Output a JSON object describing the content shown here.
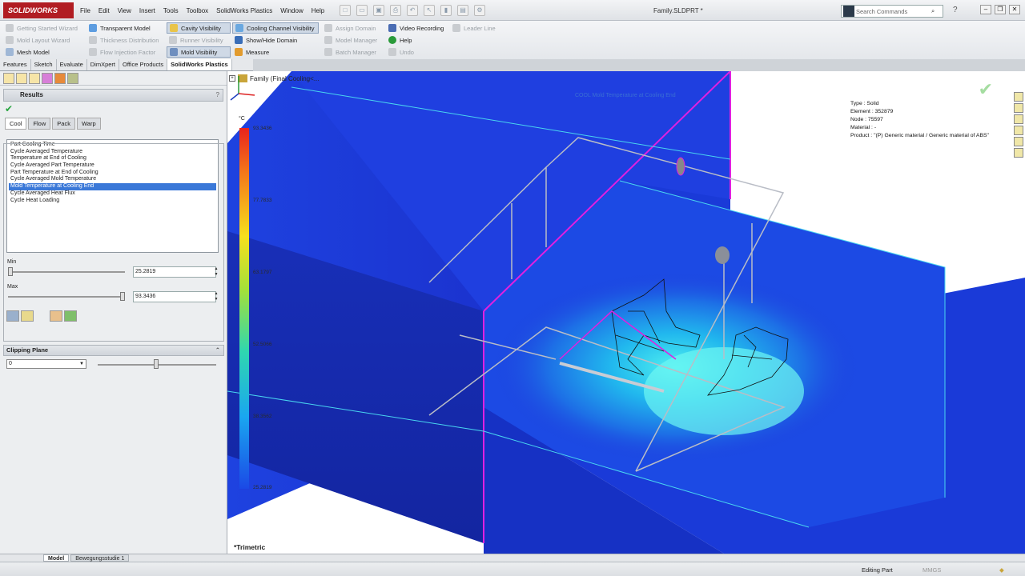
{
  "app": {
    "brand": "SOLIDWORKS",
    "document": "Family.SLDPRT *"
  },
  "menu": [
    "File",
    "Edit",
    "View",
    "Insert",
    "Tools",
    "Toolbox",
    "SolidWorks Plastics",
    "Window",
    "Help"
  ],
  "search": {
    "placeholder": "Search Commands"
  },
  "ribbon": {
    "col1": [
      "Getting Started Wizard",
      "Mold Layout Wizard",
      "Mesh Model"
    ],
    "col2": [
      "Transparent Model",
      "Thickness Distribution",
      "Flow Injection Factor"
    ],
    "col3": [
      "Cavity Visibility",
      "Runner Visibility",
      "Mold Visibility"
    ],
    "col4": [
      "Cooling Channel Visibility",
      "Show/Hide Domain",
      "Measure"
    ],
    "col5": [
      "Assign Domain",
      "Model Manager",
      "Batch Manager"
    ],
    "col6": [
      "Video Recording",
      "Help",
      "Undo"
    ],
    "col7": [
      "Leader Line"
    ]
  },
  "cmtabs": [
    "Features",
    "Sketch",
    "Evaluate",
    "DimXpert",
    "Office Products",
    "SolidWorks Plastics"
  ],
  "panel": {
    "title": "Results",
    "help": "?",
    "result_tabs": [
      "Cool",
      "Flow",
      "Pack",
      "Warp"
    ],
    "results": [
      "Part Cooling Time",
      "Cycle Averaged Temperature",
      "Temperature at End of Cooling",
      "Cycle Averaged Part Temperature",
      "Part Temperature at End of Cooling",
      "Cycle Averaged Mold Temperature",
      "Mold Temperature at Cooling End",
      "Cycle Averaged Heat Flux",
      "Cycle Heat Loading"
    ],
    "selected_index": 6,
    "min_label": "Min",
    "min_value": "25.2819",
    "min_position": 0,
    "max_label": "Max",
    "max_value": "93.3436",
    "max_position": 1,
    "clipping_title": "Clipping Plane",
    "clipping_value": "0",
    "clipping_position": 0.5
  },
  "viewport": {
    "tree_item": "Family  (Final Cooling<...",
    "plot_title": "COOL Mold Temperature at Cooling End",
    "info": [
      "Type : Solid",
      "Element : 352879",
      "Node : 75597",
      "Material : -",
      "Product :   \"(P)  Generic material / Generic material of ABS\""
    ],
    "unit": "°C",
    "ticks": [
      "93.3436",
      "77.7833",
      "63.1797",
      "52.5066",
      "38.3562",
      "25.2819"
    ],
    "view_name": "*Trimetric"
  },
  "bottom_tabs": [
    "Model",
    "Bewegungsstudie 1"
  ],
  "status": {
    "mode": "Editing Part",
    "units": "MMGS"
  },
  "colors": {
    "accent": "#3a78d8",
    "brand": "#b11d23",
    "mold_blue": "#1f3fdd",
    "edge_magenta": "#e020e0"
  }
}
